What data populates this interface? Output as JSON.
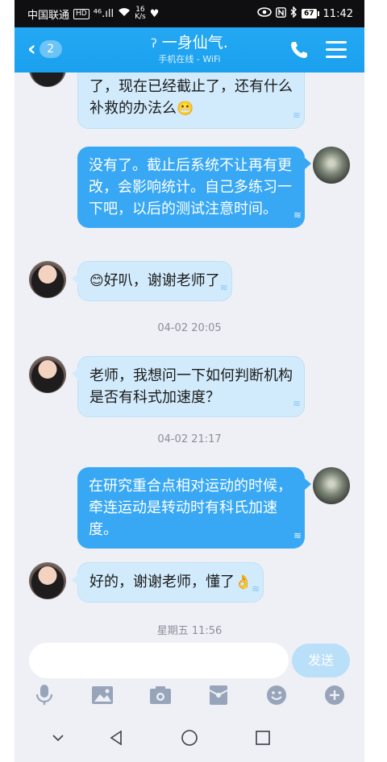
{
  "status_bar": {
    "carrier": "中国联通",
    "hd": "HD",
    "signal": "⁴⁶.ıll",
    "speed_top": "16",
    "speed_bottom": "K/s",
    "battery": "67",
    "time": "11:42"
  },
  "header": {
    "unread_count": "2",
    "title": "一身仙气.",
    "subtitle": "手机在线 - WiFi"
  },
  "messages": [
    {
      "side": "in",
      "text": "老师，我第一个板块没看就做了，现在已经截止了，还有什么补救的办法么"
    },
    {
      "side": "out",
      "text": "没有了。截止后系统不让再有更改，会影响统计。自己多练习一下吧，以后的测试注意时间。"
    },
    {
      "side": "in",
      "text": "好叭，谢谢老师了"
    },
    {
      "side": "time",
      "text": "04-02 20:05"
    },
    {
      "side": "in",
      "text": "老师，我想问一下如何判断机构是否有科式加速度？"
    },
    {
      "side": "time",
      "text": "04-02 21:17"
    },
    {
      "side": "out",
      "text": "在研究重合点相对运动的时候，牵连运动是转动时有科氏加速度。"
    },
    {
      "side": "in",
      "text": "好的，谢谢老师，懂了"
    },
    {
      "side": "time",
      "text": "星期五 11:56"
    }
  ],
  "composer": {
    "placeholder": "",
    "send_label": "发送"
  },
  "toolbar": [
    "mic-icon",
    "image-icon",
    "camera-icon",
    "red-packet-icon",
    "emoji-icon",
    "plus-icon"
  ],
  "colors": {
    "header": "#1aa0ee",
    "outgoing_bubble": "#38a8f5",
    "incoming_bubble": "#d2ebfc",
    "send_button": "#b9dff9"
  }
}
